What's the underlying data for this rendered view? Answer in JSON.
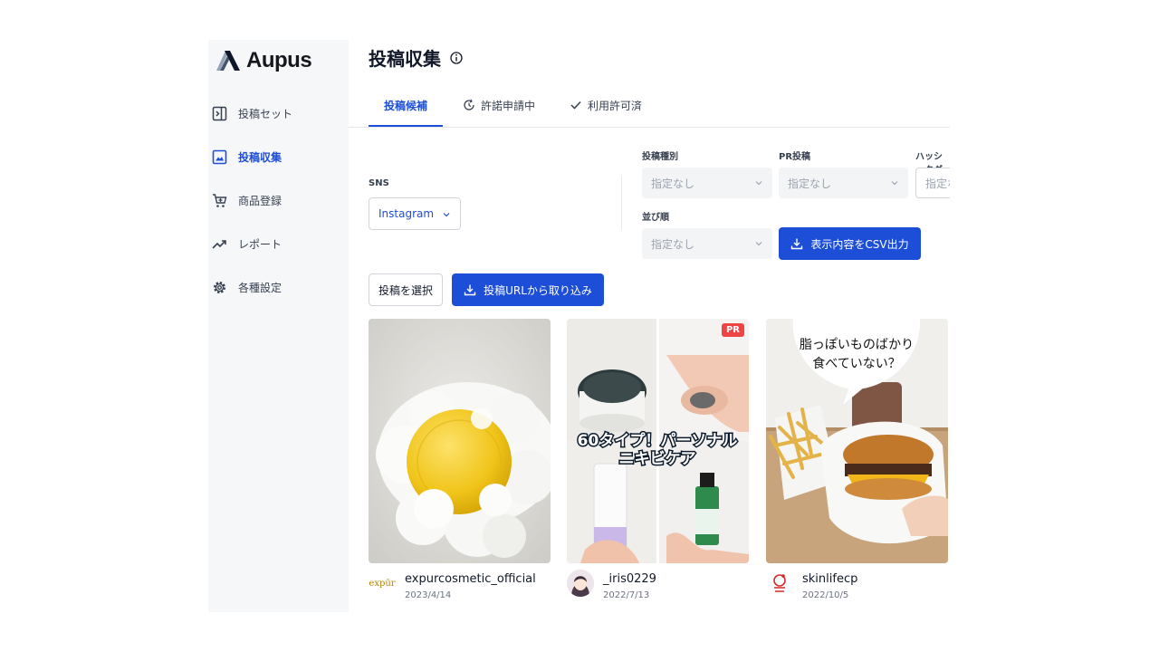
{
  "brand": {
    "name": "Aupus"
  },
  "sidebar": {
    "items": [
      {
        "label": "投稿セット",
        "icon": "panel-icon"
      },
      {
        "label": "投稿収集",
        "icon": "image-icon",
        "active": true
      },
      {
        "label": "商品登録",
        "icon": "cart-icon"
      },
      {
        "label": "レポート",
        "icon": "trend-icon"
      },
      {
        "label": "各種設定",
        "icon": "gear-icon"
      }
    ]
  },
  "page": {
    "title": "投稿収集"
  },
  "tabs": [
    {
      "label": "投稿候補",
      "active": true
    },
    {
      "label": "許諾申請中",
      "icon": "clock-arrow-icon"
    },
    {
      "label": "利用許可済",
      "icon": "check-icon"
    }
  ],
  "filters": {
    "sns": {
      "label": "SNS",
      "value": "Instagram"
    },
    "post_type": {
      "label": "投稿種別",
      "value": "指定なし"
    },
    "pr": {
      "label": "PR投稿",
      "value": "指定なし"
    },
    "hashtag": {
      "label": "ハッシュタグ",
      "placeholder": "指定なし"
    },
    "sort": {
      "label": "並び順",
      "value": "指定なし"
    }
  },
  "actions": {
    "csv_export": "表示内容をCSV出力",
    "select_posts": "投稿を選択",
    "import_url": "投稿URLから取り込み"
  },
  "posts": [
    {
      "account": "expurcosmetic_official",
      "date": "2023/4/14",
      "avatar_text": "expūr",
      "pr": false
    },
    {
      "account": "_iris0229",
      "date": "2022/7/13",
      "pr": true,
      "pr_label": "PR",
      "overlay_text_1": "60タイプ！パーソナル",
      "overlay_text_2": "ニキビケア"
    },
    {
      "account": "skinlifecp",
      "date": "2022/10/5",
      "pr": false,
      "bubble_line_1": "脂っぽいものばかり",
      "bubble_line_2": "食べていない？"
    }
  ],
  "colors": {
    "accent": "#1d4ed8",
    "pr_badge": "#ef4444",
    "sidebar_bg": "#f6f7f9"
  }
}
